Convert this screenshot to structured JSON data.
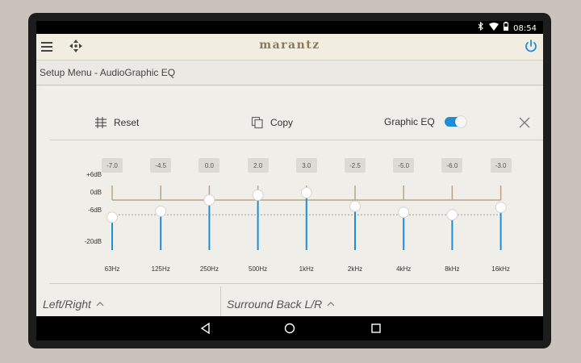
{
  "status": {
    "time": "08:54",
    "icons": [
      "bluetooth-icon",
      "wifi-icon",
      "battery-icon"
    ]
  },
  "appbar": {
    "brand": "marantz",
    "accent": "#1d8dd8",
    "brand_color": "#8a7a58"
  },
  "breadcrumb": {
    "text": "Setup Menu - AudioGraphic EQ"
  },
  "toolbar": {
    "reset_label": "Reset",
    "copy_label": "Copy",
    "graphic_eq_label": "Graphic EQ",
    "graphic_eq_on": true
  },
  "eq": {
    "y_labels": [
      "+6dB",
      "0dB",
      "-6dB",
      "-20dB"
    ],
    "y_range_db": [
      -20,
      6
    ],
    "bands": [
      {
        "freq": "63Hz",
        "value": "-7.0",
        "db": -7.0
      },
      {
        "freq": "125Hz",
        "value": "-4.5",
        "db": -4.5
      },
      {
        "freq": "250Hz",
        "value": "0.0",
        "db": 0.0
      },
      {
        "freq": "500Hz",
        "value": "2.0",
        "db": 2.0
      },
      {
        "freq": "1kHz",
        "value": "3.0",
        "db": 3.0
      },
      {
        "freq": "2kHz",
        "value": "-2.5",
        "db": -2.5
      },
      {
        "freq": "4kHz",
        "value": "-5.0",
        "db": -5.0
      },
      {
        "freq": "8kHz",
        "value": "-6.0",
        "db": -6.0
      },
      {
        "freq": "16kHz",
        "value": "-3.0",
        "db": -3.0
      }
    ]
  },
  "speakers": {
    "left": "Left/Right",
    "right": "Surround Back L/R"
  }
}
